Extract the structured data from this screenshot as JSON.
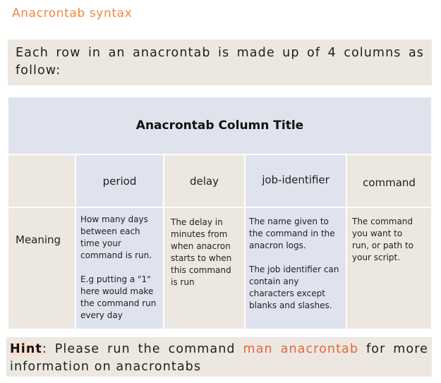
{
  "section_title": "Anacrontab syntax",
  "intro": "Each row in an anacrontab is made up of 4 columns as follow:",
  "table": {
    "title": "Anacrontab Column Title",
    "row_label": "Meaning",
    "columns": [
      {
        "header": "period",
        "meaning": [
          "How many days between each time your command is run.",
          "E.g putting a \"1\" here would make the command run every day"
        ]
      },
      {
        "header": "delay",
        "meaning": [
          "The delay in minutes from when anacron starts to when this command is run"
        ]
      },
      {
        "header": "job-identifier",
        "meaning": [
          "The name given to the command in the anacron logs.",
          "The job identifier can contain any characters except blanks and slashes."
        ]
      },
      {
        "header": "command",
        "meaning": [
          "The command you want to run, or path to your script."
        ]
      }
    ]
  },
  "hint": {
    "label": "Hint",
    "before": ": Please run the command ",
    "command": "man anacrontab",
    "after": " for more information on anacrontabs"
  }
}
